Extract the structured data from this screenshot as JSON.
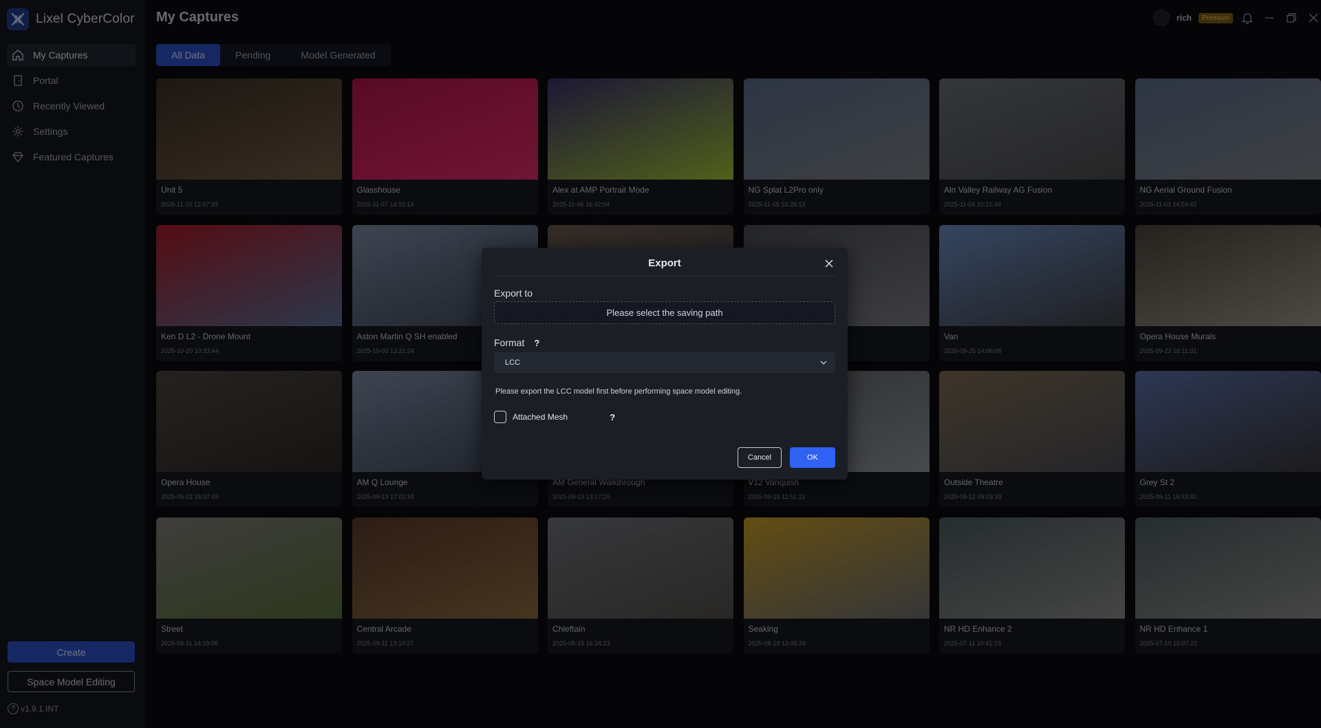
{
  "app": {
    "name": "Lixel CyberColor",
    "version": "v1.9.1.INT"
  },
  "sidebar": {
    "items": [
      {
        "label": "My Captures",
        "icon": "home-icon",
        "active": true
      },
      {
        "label": "Portal",
        "icon": "door-icon",
        "active": false
      },
      {
        "label": "Recently Viewed",
        "icon": "history-icon",
        "active": false
      },
      {
        "label": "Settings",
        "icon": "gear-icon",
        "active": false
      },
      {
        "label": "Featured Captures",
        "icon": "diamond-icon",
        "active": false
      }
    ],
    "create_label": "Create",
    "space_label": "Space Model Editing"
  },
  "header": {
    "title": "My Captures",
    "username": "rich",
    "badge": "Premium"
  },
  "tabs": [
    {
      "label": "All Data",
      "active": true
    },
    {
      "label": "Pending",
      "active": false
    },
    {
      "label": "Model Generated",
      "active": false
    }
  ],
  "captures": [
    {
      "title": "Unit 5",
      "date": "2025-11-10 12:07:33"
    },
    {
      "title": "Glasshouse",
      "date": "2025-11-07 14:10:14"
    },
    {
      "title": "Alex at AMP Portrait Mode",
      "date": "2025-11-06 16:42:04"
    },
    {
      "title": "NG Splat L2Pro only",
      "date": "2025-11-05 15:26:13"
    },
    {
      "title": "Aln Valley Railway AG Fusion",
      "date": "2025-11-04 10:21:44"
    },
    {
      "title": "NG Aerial Ground Fusion",
      "date": "2025-11-03 14:54:42"
    },
    {
      "title": "Ken D L2 - Drone Mount",
      "date": "2025-10-20 10:33:44"
    },
    {
      "title": "Aston Martin Q SH enabled",
      "date": "2025-10-03 12:21:34"
    },
    {
      "title": "",
      "date": ""
    },
    {
      "title": "",
      "date": ""
    },
    {
      "title": "Van",
      "date": "2025-09-25 14:06:08"
    },
    {
      "title": "Opera House Murals",
      "date": "2025-09-23 16:11:31"
    },
    {
      "title": "Opera House",
      "date": "2025-09-22 15:07:09"
    },
    {
      "title": "AM Q Lounge",
      "date": "2025-09-19 17:01:55"
    },
    {
      "title": "AM General Walkthrough",
      "date": "2025-09-19 13:17:29"
    },
    {
      "title": "V12 Vanquish",
      "date": "2025-09-19 11:51:22"
    },
    {
      "title": "Outside Theatre",
      "date": "2025-09-12 09:03:33"
    },
    {
      "title": "Grey St 2",
      "date": "2025-09-11 16:53:40"
    },
    {
      "title": "Street",
      "date": "2025-09-11 14:19:06"
    },
    {
      "title": "Central Arcade",
      "date": "2025-09-11 13:10:27"
    },
    {
      "title": "Chieftain",
      "date": "2025-08-19 16:34:23"
    },
    {
      "title": "Seaking",
      "date": "2025-08-19 13:05:39"
    },
    {
      "title": "NR HD Enhance 2",
      "date": "2025-07-11 10:41:19"
    },
    {
      "title": "NR HD Enhance 1",
      "date": "2025-07-10 15:07:22"
    }
  ],
  "thumb_colors": [
    [
      "#3a2f24",
      "#6d5a45"
    ],
    [
      "#b0154a",
      "#e22a6a"
    ],
    [
      "#3b2f6b",
      "#9fc235"
    ],
    [
      "#5a6a88",
      "#7c7f86"
    ],
    [
      "#6a6d72",
      "#4b4b4d"
    ],
    [
      "#5a6a88",
      "#7c7f86"
    ],
    [
      "#a81a26",
      "#586f95"
    ],
    [
      "#7c8aa3",
      "#3c4555"
    ],
    [
      "#6b5a50",
      "#3a3a3e"
    ],
    [
      "#4c4d52",
      "#7a7b80"
    ],
    [
      "#6a8bbf",
      "#3f3f45"
    ],
    [
      "#4a4238",
      "#9a9388"
    ],
    [
      "#4a4440",
      "#2c2826"
    ],
    [
      "#7c8aa3",
      "#3c4555"
    ],
    [
      "#50484a",
      "#2f2c2e"
    ],
    [
      "#5d6064",
      "#8f9296"
    ],
    [
      "#7c6b52",
      "#4a4a52"
    ],
    [
      "#5b6fa8",
      "#38373a"
    ],
    [
      "#7d7a77",
      "#5b6f3c"
    ],
    [
      "#5a3a2a",
      "#8a6a40"
    ],
    [
      "#6e7075",
      "#514f4c"
    ],
    [
      "#c59a24",
      "#6a6c70"
    ],
    [
      "#4d5a5a",
      "#8a8a88"
    ],
    [
      "#4d5a5a",
      "#8a8a88"
    ]
  ],
  "dialog": {
    "title": "Export",
    "export_to_label": "Export to",
    "path_placeholder": "Please select the saving path",
    "format_label": "Format",
    "format_value": "LCC",
    "note": "Please export the LCC model first before performing space model editing.",
    "mesh_label": "Attached Mesh",
    "cancel_label": "Cancel",
    "ok_label": "OK"
  }
}
